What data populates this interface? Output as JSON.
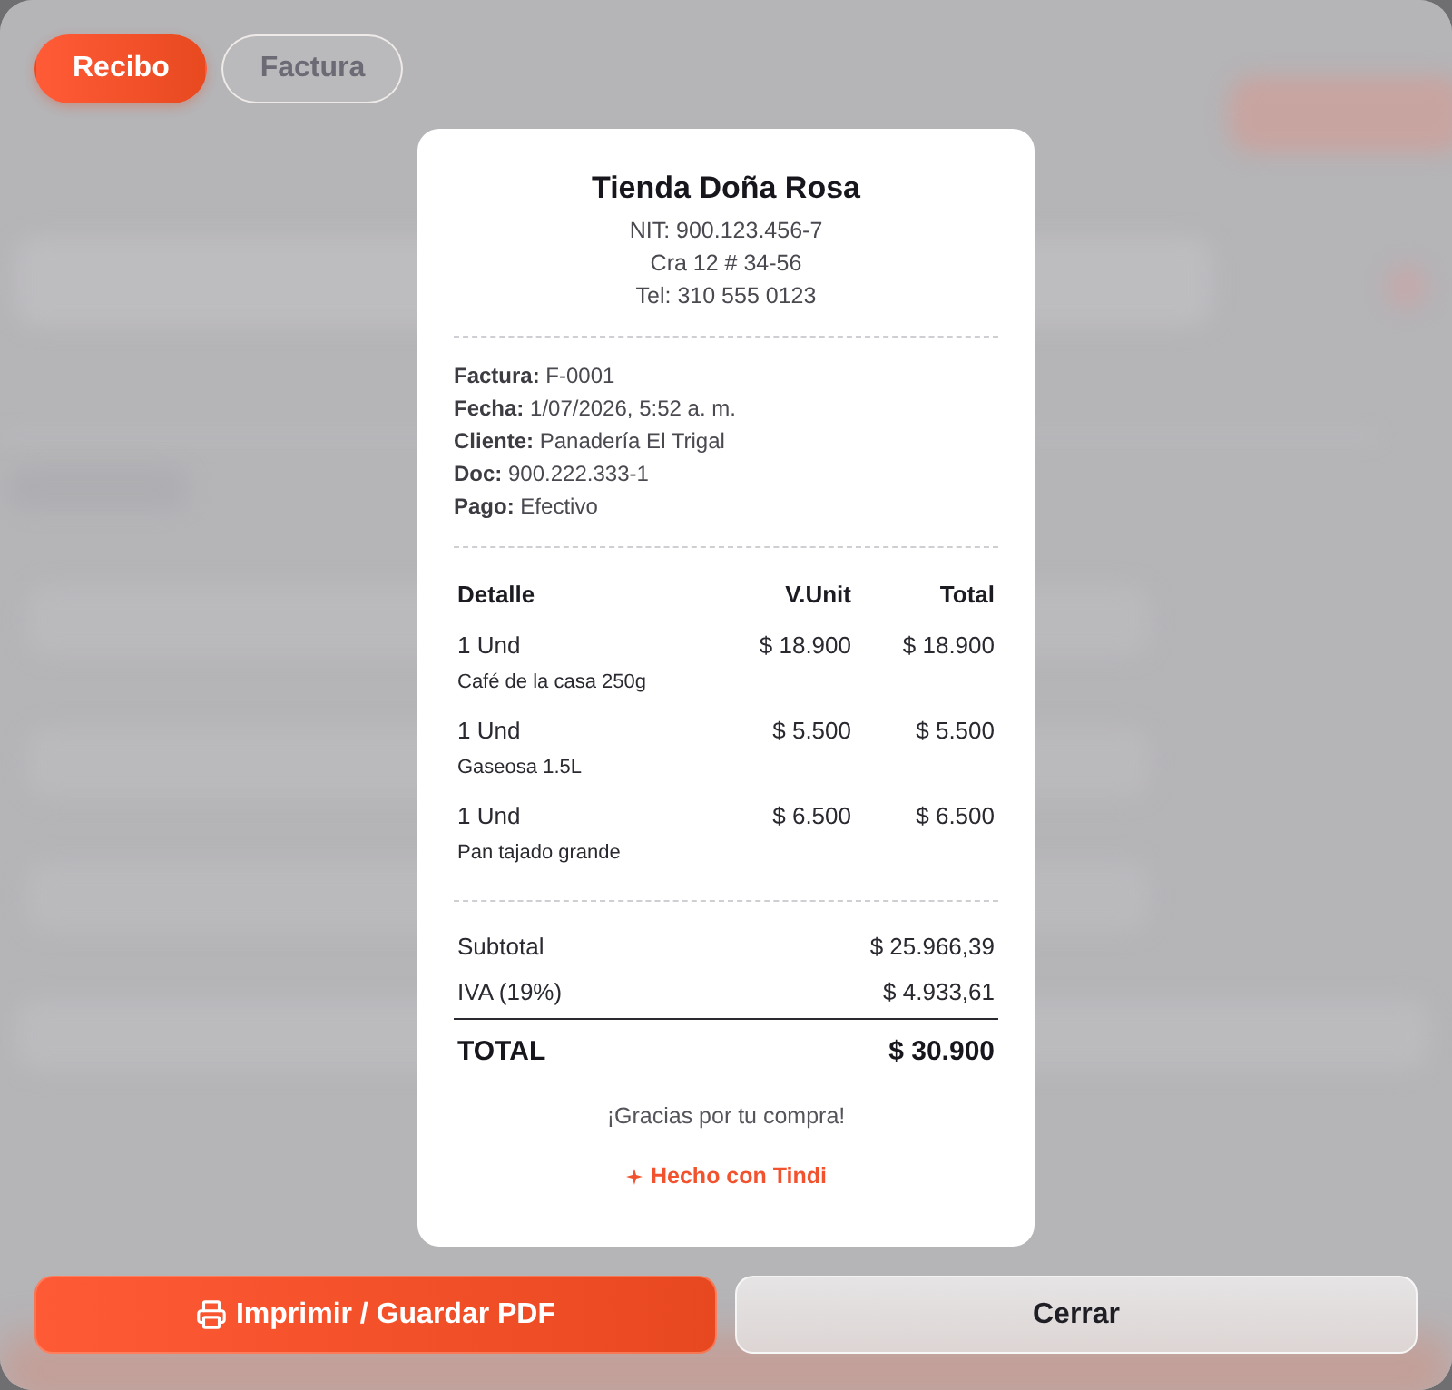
{
  "tabs": [
    {
      "label": "Recibo",
      "selected": true
    },
    {
      "label": "Factura",
      "selected": false
    }
  ],
  "receipt": {
    "store_name": "Tienda Doña Rosa",
    "header_lines": [
      "NIT: 900.123.456-7",
      "Cra 12 # 34-56",
      "Tel: 310 555 0123"
    ],
    "details": [
      "**Factura:** F-0001",
      "**Fecha:** 1/07/2026, 5:52 a. m.",
      "**Cliente:** Panadería El Trigal",
      "**Doc:** 900.222.333-1",
      "**Pago:** Efectivo"
    ],
    "columns": [
      "Detalle",
      "V.Unit",
      "Total"
    ],
    "items": [
      {
        "quantity": "1 Und",
        "description": "Café de la casa 250g",
        "unit_price": "$ 18.900",
        "total": "$ 18.900"
      },
      {
        "quantity": "1 Und",
        "description": "Gaseosa 1.5L",
        "unit_price": "$ 5.500",
        "total": "$ 5.500"
      },
      {
        "quantity": "1 Und",
        "description": "Pan tajado grande",
        "unit_price": "$ 6.500",
        "total": "$ 6.500"
      }
    ],
    "summary": [
      {
        "label": "Subtotal",
        "value": "$ 25.966,39"
      },
      {
        "label": "IVA (19%)",
        "value": "$ 4.933,61"
      }
    ],
    "total": {
      "label": "TOTAL",
      "value": "$ 30.900"
    },
    "thanks": "¡Gracias por tu compra!",
    "credit": "Hecho con Tindi"
  },
  "buttons": [
    {
      "label": "Imprimir / Guardar PDF",
      "kind": "primary"
    },
    {
      "label": "Cerrar",
      "kind": "secondary"
    }
  ]
}
